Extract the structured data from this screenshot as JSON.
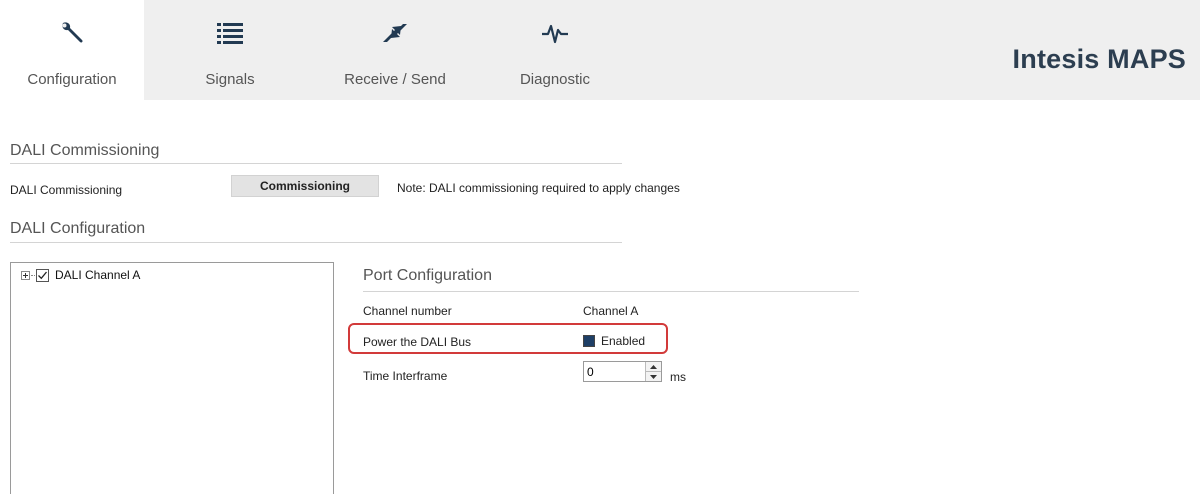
{
  "app": {
    "brand": "Intesis MAPS"
  },
  "tabs": [
    {
      "label": "Configuration",
      "icon": "wrench-icon",
      "active": true
    },
    {
      "label": "Signals",
      "icon": "list-icon",
      "active": false
    },
    {
      "label": "Receive / Send",
      "icon": "transfer-arrows-icon",
      "active": false
    },
    {
      "label": "Diagnostic",
      "icon": "pulse-icon",
      "active": false
    }
  ],
  "commissioning": {
    "section_title": "DALI Commissioning",
    "row_label": "DALI Commissioning",
    "button_label": "Commissioning",
    "note": "Note: DALI commissioning required to apply changes"
  },
  "configuration": {
    "section_title": "DALI Configuration",
    "tree": {
      "items": [
        {
          "label": "DALI Channel A",
          "checked": true
        }
      ]
    }
  },
  "port": {
    "title": "Port Configuration",
    "channel_number": {
      "label": "Channel number",
      "value": "Channel A"
    },
    "power_bus": {
      "label": "Power the DALI Bus",
      "checkbox_label": "Enabled",
      "checked": true
    },
    "time_interframe": {
      "label": "Time Interframe",
      "value": "0",
      "unit": "ms"
    }
  },
  "colors": {
    "accent": "#2c3e50",
    "highlight": "#d23a3a",
    "checkbox_fill": "#1e3f66",
    "topbar": "#efefef"
  }
}
